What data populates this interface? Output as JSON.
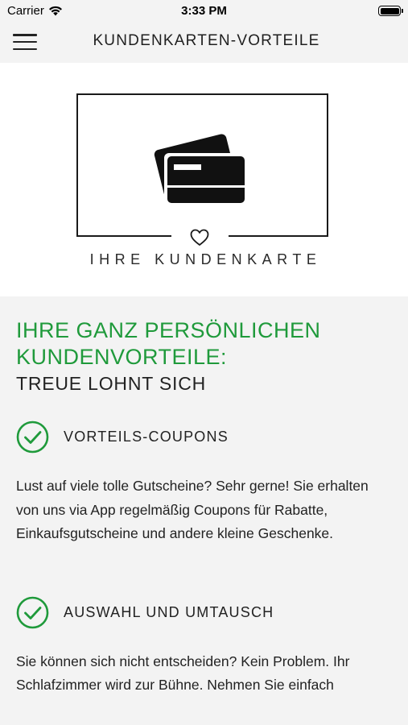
{
  "status_bar": {
    "carrier": "Carrier",
    "time": "3:33 PM"
  },
  "nav": {
    "title": "KUNDENKARTEN-VORTEILE",
    "menu_icon": "hamburger-menu-icon"
  },
  "hero": {
    "caption": "IHRE KUNDENKARTE",
    "icons": [
      "credit-cards-icon",
      "heart-icon"
    ]
  },
  "main": {
    "headline": "IHRE GANZ PERSÖNLICHEN KUNDENVORTEILE:",
    "subheadline": "TREUE LOHNT SICH",
    "benefits": [
      {
        "icon": "check-circle-icon",
        "title": "VORTEILS-COUPONS",
        "text": "Lust auf viele tolle Gutscheine? Sehr gerne! Sie erhalten von uns via App regelmäßig Coupons für Rabatte, Einkaufsgutscheine und andere kleine Geschenke."
      },
      {
        "icon": "check-circle-icon",
        "title": "AUSWAHL UND UMTAUSCH",
        "text": "Sie können sich nicht entscheiden? Kein Problem. Ihr Schlafzimmer wird zur Bühne. Nehmen Sie einfach"
      }
    ]
  },
  "colors": {
    "accent_green": "#1f9a3b",
    "background": "#f3f3f3",
    "hero_background": "#ffffff"
  }
}
